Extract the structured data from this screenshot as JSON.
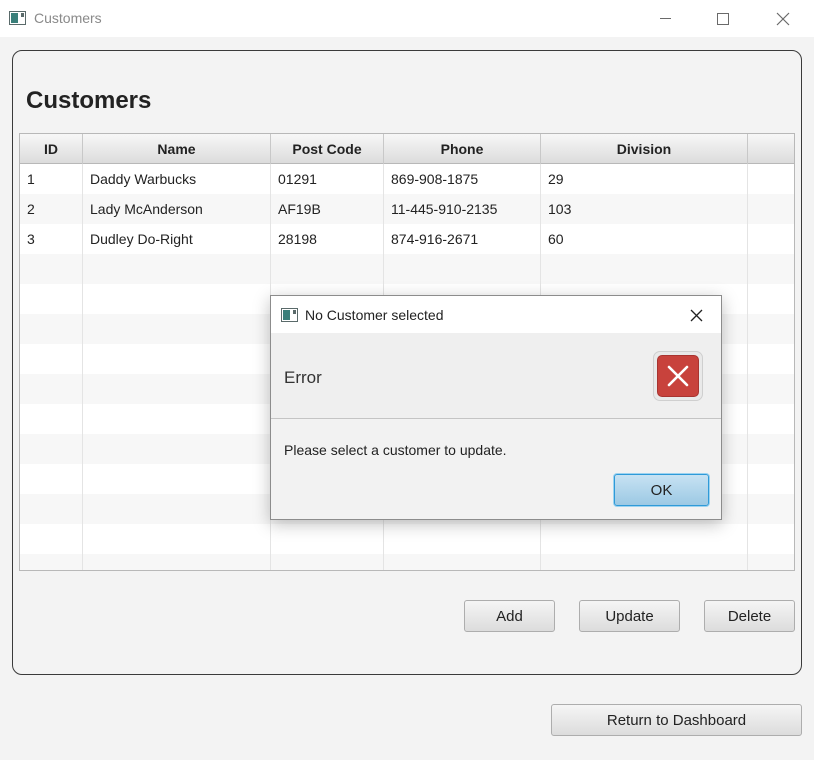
{
  "window": {
    "title": "Customers"
  },
  "page": {
    "title": "Customers"
  },
  "table": {
    "columns": [
      "ID",
      "Name",
      "Post Code",
      "Phone",
      "Division"
    ],
    "rows": [
      [
        "1",
        "Daddy Warbucks",
        "01291",
        "869-908-1875",
        "29"
      ],
      [
        "2",
        "Lady McAnderson",
        "AF19B",
        "11-445-910-2135",
        "103"
      ],
      [
        "3",
        "Dudley Do-Right",
        "28198",
        "874-916-2671",
        "60"
      ]
    ]
  },
  "buttons": {
    "add": "Add",
    "update": "Update",
    "delete": "Delete",
    "return": "Return to Dashboard"
  },
  "dialog": {
    "title": "No Customer selected",
    "header": "Error",
    "content": "Please select a customer to update.",
    "ok": "OK",
    "icon": "error-icon"
  },
  "colors": {
    "error": "#c8423c",
    "default_button_border": "#2f9ad8"
  }
}
